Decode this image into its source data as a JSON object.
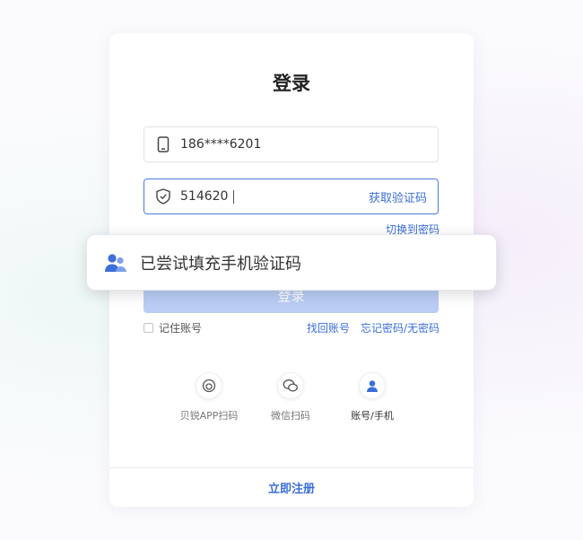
{
  "login": {
    "title": "登录",
    "phone_value": "186****6201",
    "code_value": "514620",
    "get_code_label": "获取验证码",
    "switch_password_label": "切换到密码",
    "login_button": "登录",
    "remember_label": "记住账号",
    "recover_account": "找回账号",
    "forgot_password": "忘记密码/无密码",
    "methods": [
      {
        "label": "贝锐APP扫码",
        "icon": "app-scan-icon"
      },
      {
        "label": "微信扫码",
        "icon": "wechat-icon"
      },
      {
        "label": "账号/手机",
        "icon": "user-icon"
      }
    ],
    "register_label": "立即注册"
  },
  "toast": {
    "message": "已尝试填充手机验证码",
    "icon": "users-icon"
  },
  "colors": {
    "accent": "#3b6fd8",
    "button_disabled": "#b9cdf5"
  }
}
